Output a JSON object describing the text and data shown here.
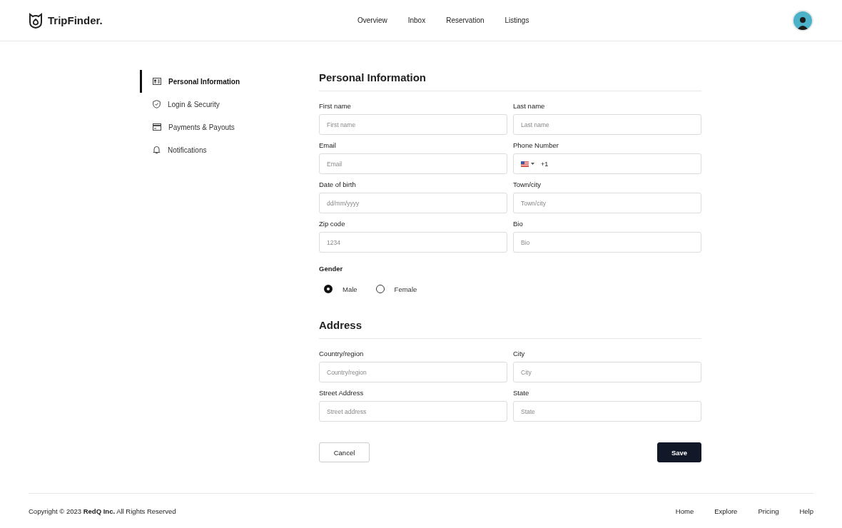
{
  "header": {
    "brand": "TripFinder.",
    "nav": [
      {
        "label": "Overview"
      },
      {
        "label": "Inbox"
      },
      {
        "label": "Reservation"
      },
      {
        "label": "Listings"
      }
    ]
  },
  "sidebar": {
    "items": [
      {
        "label": "Personal Information",
        "selected": true
      },
      {
        "label": "Login & Security",
        "selected": false
      },
      {
        "label": "Payments & Payouts",
        "selected": false
      },
      {
        "label": "Notifications",
        "selected": false
      }
    ]
  },
  "personal": {
    "title": "Personal Information",
    "fields": [
      {
        "label": "First name",
        "kind": "text",
        "placeholder": "First name"
      },
      {
        "label": "Last name",
        "kind": "text",
        "placeholder": "Last name"
      },
      {
        "label": "Email",
        "kind": "text",
        "placeholder": "Email"
      },
      {
        "label": "Phone Number",
        "kind": "phone",
        "value": "+1"
      },
      {
        "label": "Date of birth",
        "kind": "text",
        "placeholder": "dd/mm/yyyy"
      },
      {
        "label": "Town/city",
        "kind": "text",
        "placeholder": "Town/city"
      },
      {
        "label": "Zip code",
        "kind": "text",
        "placeholder": "1234"
      },
      {
        "label": "Bio",
        "kind": "text",
        "placeholder": "Bio"
      }
    ],
    "gender": {
      "label": "Gender",
      "options": [
        {
          "label": "Male",
          "selected": true
        },
        {
          "label": "Female",
          "selected": false
        }
      ]
    }
  },
  "address": {
    "title": "Address",
    "fields": [
      {
        "label": "Country/region",
        "kind": "text",
        "placeholder": "Country/region"
      },
      {
        "label": "City",
        "kind": "text",
        "placeholder": "City"
      },
      {
        "label": "Street Address",
        "kind": "text",
        "placeholder": "Street address"
      },
      {
        "label": "State",
        "kind": "text",
        "placeholder": "State"
      }
    ]
  },
  "buttons": {
    "cancel": "Cancel",
    "save": "Save"
  },
  "footer": {
    "copyright": "Copyright © 2023 **RedQ Inc.** All Rights Reserved",
    "links": [
      {
        "label": "Home"
      },
      {
        "label": "Explore"
      },
      {
        "label": "Pricing"
      },
      {
        "label": "Help"
      }
    ]
  }
}
